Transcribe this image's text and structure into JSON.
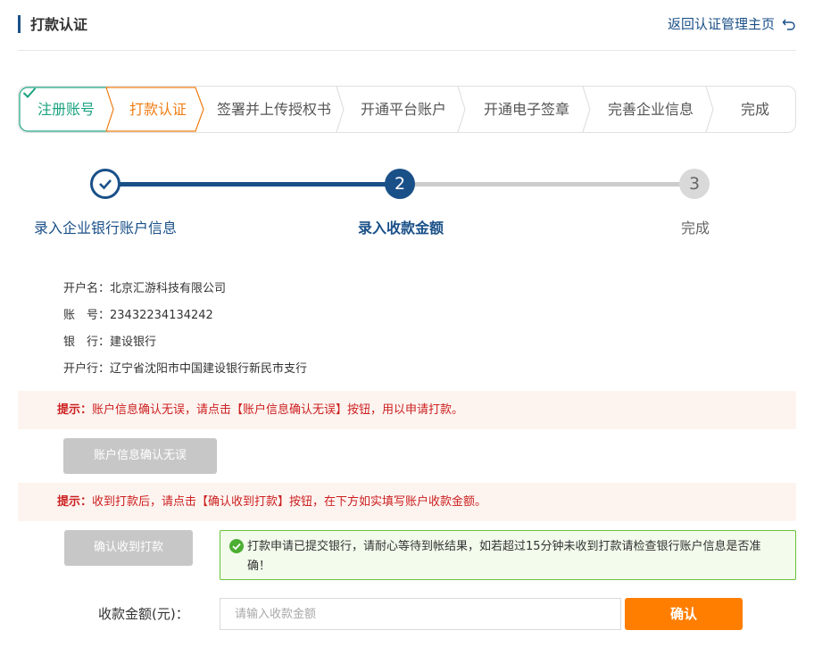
{
  "header": {
    "title": "打款认证",
    "back_link": "返回认证管理主页"
  },
  "tabs": [
    {
      "label": "注册账号",
      "state": "done"
    },
    {
      "label": "打款认证",
      "state": "active"
    },
    {
      "label": "签署并上传授权书",
      "state": "todo"
    },
    {
      "label": "开通平台账户",
      "state": "todo"
    },
    {
      "label": "开通电子签章",
      "state": "todo"
    },
    {
      "label": "完善企业信息",
      "state": "todo"
    },
    {
      "label": "完成",
      "state": "todo"
    }
  ],
  "progress": {
    "steps": [
      {
        "label": "录入企业银行账户信息",
        "marker": ""
      },
      {
        "label": "录入收款金额",
        "marker": "2"
      },
      {
        "label": "完成",
        "marker": "3"
      }
    ]
  },
  "account": {
    "name_label": "开户名：",
    "name_value": "北京汇游科技有限公司",
    "number_label": "账　号：",
    "number_value": "23432234134242",
    "bank_label": "银　行：",
    "bank_value": "建设银行",
    "branch_label": "开户行：",
    "branch_value": "辽宁省沈阳市中国建设银行新民市支行"
  },
  "notices": {
    "tip_label": "提示：",
    "notice1": "账户信息确认无误，请点击【账户信息确认无误】按钮，用以申请打款。",
    "notice2": "收到打款后，请点击【确认收到打款】按钮，在下方如实填写账户收款金额。"
  },
  "buttons": {
    "confirm_info": "账户信息确认无误",
    "confirm_received": "确认收到打款",
    "confirm": "确认"
  },
  "success_message": "打款申请已提交银行，请耐心等待到帐结果，如若超过15分钟未收到打款请检查银行账户信息是否准确！",
  "amount": {
    "label": "收款金额(元)：",
    "placeholder": "请输入收款金额",
    "value": ""
  },
  "colors": {
    "primary": "#1a5088",
    "done_tab": "#1aa281",
    "active_tab": "#ef7d13",
    "confirm_button": "#ff7e00",
    "notice_text": "#cc1f1f",
    "success_border": "#67c23a"
  },
  "icons": {
    "back": "undo-arrow-icon",
    "step_done": "check-icon",
    "success": "check-circle-icon"
  }
}
